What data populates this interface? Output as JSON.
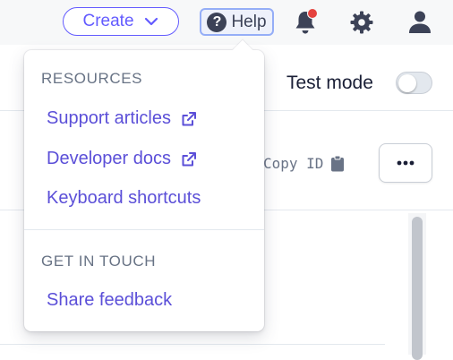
{
  "topbar": {
    "create_label": "Create",
    "help_label": "Help",
    "help_icon_glyph": "?",
    "notification_badge": true,
    "icons": [
      "chevron-down-icon",
      "question-icon",
      "bell-icon",
      "gear-icon",
      "user-icon"
    ]
  },
  "page": {
    "test_mode_label": "Test mode",
    "test_mode_enabled": false,
    "copy_id_label": "Copy ID",
    "more_icon": "ellipsis-icon"
  },
  "help_menu": {
    "resources_heading": "RESOURCES",
    "resources": [
      {
        "label": "Support articles",
        "external": true
      },
      {
        "label": "Developer docs",
        "external": true
      },
      {
        "label": "Keyboard shortcuts",
        "external": false
      }
    ],
    "contact_heading": "GET IN TOUCH",
    "contact": [
      {
        "label": "Share feedback",
        "external": false
      }
    ]
  },
  "colors": {
    "accent": "#635bff",
    "link": "#5b4fd8",
    "muted": "#687385",
    "badge": "#e5423e",
    "topbar_bg": "#f7f8f9"
  }
}
